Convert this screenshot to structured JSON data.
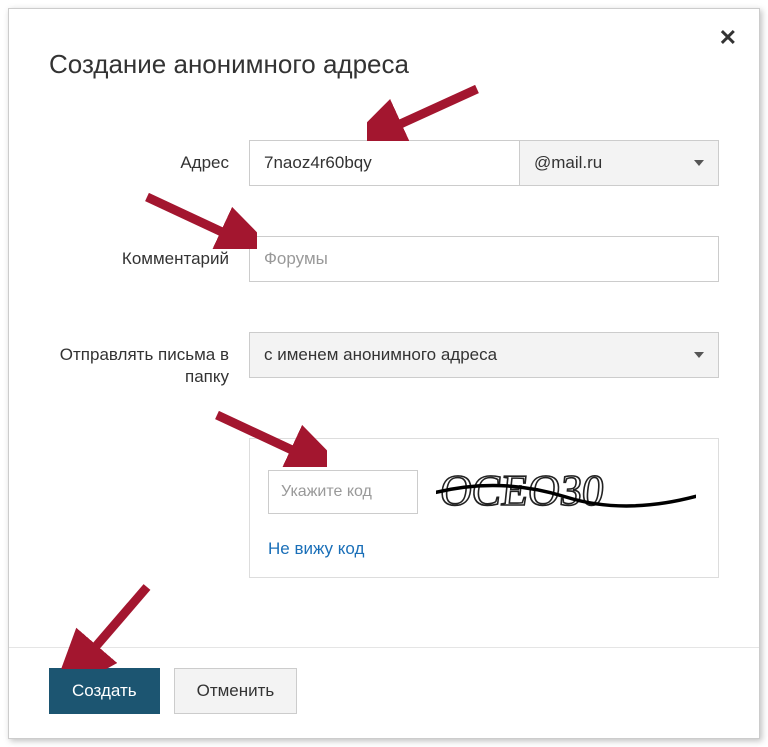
{
  "modal": {
    "title": "Создание анонимного адреса"
  },
  "form": {
    "address": {
      "label": "Адрес",
      "value": "7naoz4r60bqy",
      "domain": "@mail.ru"
    },
    "comment": {
      "label": "Комментарий",
      "placeholder": "Форумы"
    },
    "folder": {
      "label": "Отправлять письма в папку",
      "value": "с именем анонимного адреса"
    },
    "captcha": {
      "placeholder": "Укажите код",
      "resend_link": "Не вижу код",
      "captcha_text": "OCEO30"
    }
  },
  "buttons": {
    "create": "Создать",
    "cancel": "Отменить"
  }
}
